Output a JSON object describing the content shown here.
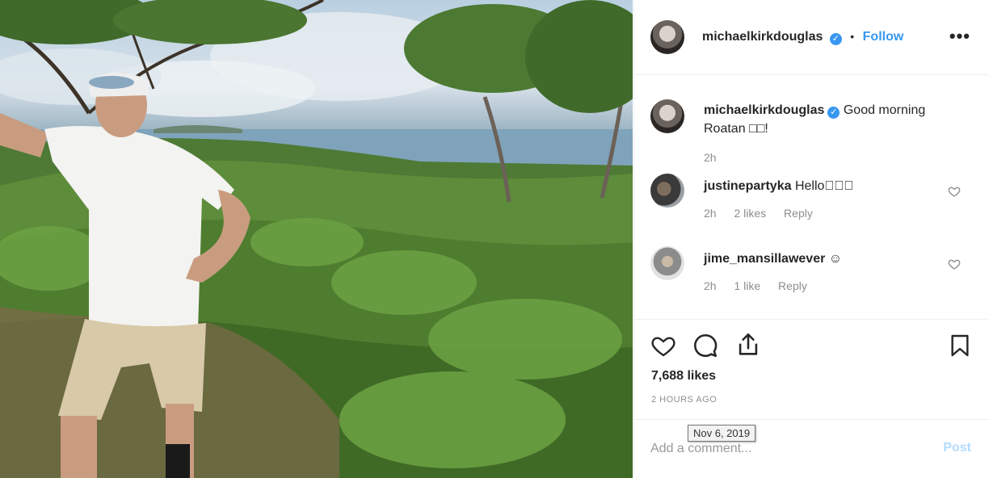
{
  "post": {
    "author": "michaelkirkdouglas",
    "follow_label": "Follow",
    "dot": "•",
    "more_label": "•••",
    "verified_mark": "✓",
    "likes": "7,688 likes",
    "posted": "2 HOURS AGO",
    "date_tooltip": "Nov 6, 2019",
    "photo_description": "Man in white t-shirt and cap on a hillside overlooking green vegetation and the sea"
  },
  "caption": {
    "author": "michaelkirkdouglas",
    "text_line1": "Good morning",
    "text_line2": "Roatan □□!",
    "age": "2h"
  },
  "comments": [
    {
      "author": "justinepartyka",
      "text": "Hello🏿🏿🏿",
      "age": "2h",
      "likes": "2 likes",
      "reply": "Reply"
    },
    {
      "author": "jime_mansillawever",
      "text": "☺",
      "age": "2h",
      "likes": "1 like",
      "reply": "Reply"
    }
  ],
  "add_comment": {
    "placeholder": "Add a comment...",
    "post_label": "Post"
  },
  "colors": {
    "accent": "#3897f0",
    "post_disabled": "#b3dbff",
    "muted": "#8e8e8e"
  },
  "icons": [
    "heart-icon",
    "comment-icon",
    "share-icon",
    "bookmark-icon",
    "verified-badge-icon",
    "more-options-icon"
  ]
}
